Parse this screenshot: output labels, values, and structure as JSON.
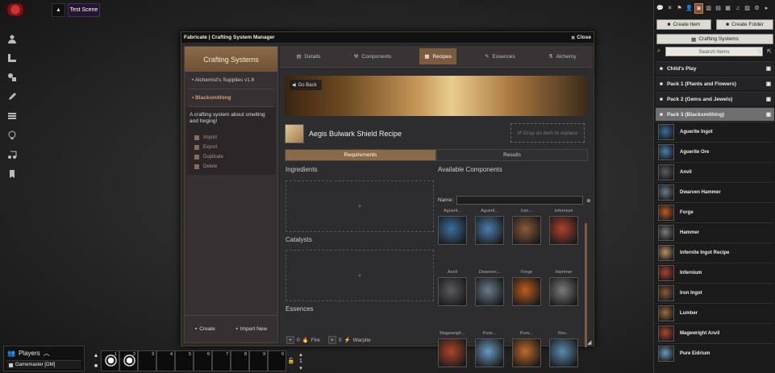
{
  "topbar": {
    "scene_tab": "Test Scene",
    "nav_toggle_icon": "chevron-up-icon",
    "logo_icon": "foundry-logo-icon"
  },
  "left_controls": [
    {
      "icon": "user-icon"
    },
    {
      "icon": "ruler-icon"
    },
    {
      "icon": "shapes-icon"
    },
    {
      "icon": "pencil-icon"
    },
    {
      "icon": "grid-icon"
    },
    {
      "icon": "lightbulb-icon"
    },
    {
      "icon": "music-icon"
    },
    {
      "icon": "bookmark-icon"
    }
  ],
  "window": {
    "title": "Fabricate | Crafting System Manager",
    "close_label": "Close",
    "systems_panel": {
      "title": "Crafting Systems",
      "systems": [
        {
          "name": "Alchemist's Supplies v1.6",
          "active": false
        },
        {
          "name": "Blacksmithing",
          "active": true
        }
      ],
      "description": "A crafting system about smelting and forging!",
      "actions": [
        "Import",
        "Export",
        "Duplicate",
        "Delete"
      ],
      "footer": {
        "create": "Create",
        "import_new": "Import New"
      }
    },
    "tabs": [
      {
        "label": "Details",
        "active": false
      },
      {
        "label": "Components",
        "active": false
      },
      {
        "label": "Recipes",
        "active": true
      },
      {
        "label": "Essences",
        "active": false
      },
      {
        "label": "Alchemy",
        "active": false
      }
    ],
    "recipe": {
      "go_back": "Go Back",
      "name": "Aegis Bulwark Shield Recipe",
      "drop_hint": "Drop an item to replace"
    },
    "subtabs": [
      {
        "label": "Requirements",
        "active": true
      },
      {
        "label": "Results",
        "active": false
      }
    ],
    "requirements": {
      "ingredients": "Ingredients",
      "catalysts": "Catalysts",
      "essences": "Essences",
      "plus": "+",
      "essence_list": [
        {
          "count": "0",
          "name": "Fire"
        },
        {
          "count": "0",
          "name": "Warpite"
        }
      ]
    },
    "available": {
      "title": "Available Components",
      "name_label": "Name:",
      "components": [
        {
          "label": "Aguerit...",
          "color": "#3a6f9e"
        },
        {
          "label": "Aguerit...",
          "color": "#4a7fae"
        },
        {
          "label": "Iron...",
          "color": "#8a5a3a"
        },
        {
          "label": "Infernium",
          "color": "#b0402a"
        },
        {
          "label": "Anvil",
          "color": "#5a5a60"
        },
        {
          "label": "Dwarven...",
          "color": "#6a7a8a"
        },
        {
          "label": "Forge",
          "color": "#c05a20"
        },
        {
          "label": "Hammer",
          "color": "#7a7a7a"
        },
        {
          "label": "Magewrigh...",
          "color": "#b0452a"
        },
        {
          "label": "Pure...",
          "color": "#6a9ac0"
        },
        {
          "label": "Pure...",
          "color": "#c06a2a"
        },
        {
          "label": "Rev...",
          "color": "#5a8ab0"
        }
      ]
    }
  },
  "sidebar": {
    "tab_icons": [
      "chat-icon",
      "swords-icon",
      "map-icon",
      "user-icon",
      "suitcase-icon",
      "book-icon",
      "journal-icon",
      "cards-icon",
      "music-icon",
      "compendium-icon",
      "gear-icon",
      "arrow-right-icon"
    ],
    "create_item": "Create Item",
    "create_folder": "Create Folder",
    "crafting_systems": "Crafting Systems",
    "search_placeholder": "Search Items",
    "folders": [
      {
        "name": "Child's Play",
        "open": false
      },
      {
        "name": "Pack 1 (Plants and Flowers)",
        "open": false
      },
      {
        "name": "Pack 2 (Gems and Jewels)",
        "open": false
      },
      {
        "name": "Pack 3 (Blacksmithing)",
        "open": true
      }
    ],
    "items": [
      {
        "name": "Aguerite Ingot",
        "color": "#3a6f9e"
      },
      {
        "name": "Aguerite Ore",
        "color": "#4a7fae"
      },
      {
        "name": "Anvil",
        "color": "#5a5a60"
      },
      {
        "name": "Dwarven Hammer",
        "color": "#6a7a8a"
      },
      {
        "name": "Forge",
        "color": "#c05a20"
      },
      {
        "name": "Hammer",
        "color": "#7a7a7a"
      },
      {
        "name": "Infernite Ingot Recipe",
        "color": "#b89060"
      },
      {
        "name": "Infernium",
        "color": "#b0402a"
      },
      {
        "name": "Iron Ingot",
        "color": "#8a5a3a"
      },
      {
        "name": "Lumber",
        "color": "#9a6a3a"
      },
      {
        "name": "Magewright Anvil",
        "color": "#b0452a"
      },
      {
        "name": "Pure Eidrium",
        "color": "#6a9ac0"
      }
    ]
  },
  "players": {
    "title": "Players",
    "gm": "Gamemaster [GM]"
  },
  "hotbar": {
    "slots": [
      "1",
      "2",
      "3",
      "4",
      "5",
      "6",
      "7",
      "8",
      "9",
      "0"
    ],
    "page": "1"
  }
}
